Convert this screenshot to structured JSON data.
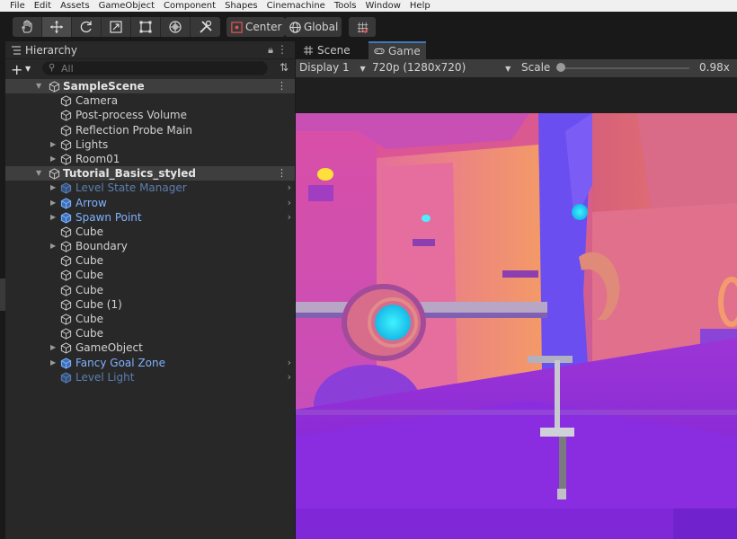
{
  "menu": [
    "File",
    "Edit",
    "Assets",
    "GameObject",
    "Component",
    "Shapes",
    "Cinemachine",
    "Tools",
    "Window",
    "Help"
  ],
  "toolbar": {
    "tools": [
      {
        "name": "hand-tool",
        "icon": "hand-icon"
      },
      {
        "name": "move-tool",
        "icon": "move-icon",
        "active": true
      },
      {
        "name": "rotate-tool",
        "icon": "rotate-icon"
      },
      {
        "name": "scale-tool",
        "icon": "scale-icon"
      },
      {
        "name": "rect-tool",
        "icon": "rect-icon"
      },
      {
        "name": "transform-tool",
        "icon": "transform-icon"
      },
      {
        "name": "custom-tool",
        "icon": "tools-icon"
      }
    ],
    "pivot_label": "Center",
    "space_label": "Global"
  },
  "hierarchy": {
    "title": "Hierarchy",
    "search_placeholder": "All",
    "scenes": [
      {
        "label": "SampleScene",
        "items": [
          {
            "label": "Camera",
            "style": "normal",
            "fold": false
          },
          {
            "label": "Post-process Volume",
            "style": "normal",
            "fold": false
          },
          {
            "label": "Reflection Probe Main",
            "style": "normal",
            "fold": false
          },
          {
            "label": "Lights",
            "style": "normal",
            "fold": true
          },
          {
            "label": "Room01",
            "style": "normal",
            "fold": true
          }
        ]
      },
      {
        "label": "Tutorial_Basics_styled",
        "items": [
          {
            "label": "Level State Manager",
            "style": "prefab-dim",
            "fold": true,
            "chevron": true
          },
          {
            "label": "Arrow",
            "style": "prefab",
            "fold": true,
            "chevron": true
          },
          {
            "label": "Spawn Point",
            "style": "prefab",
            "fold": true,
            "chevron": true
          },
          {
            "label": "Cube",
            "style": "normal",
            "fold": false
          },
          {
            "label": "Boundary",
            "style": "normal",
            "fold": true
          },
          {
            "label": "Cube",
            "style": "normal",
            "fold": false
          },
          {
            "label": "Cube",
            "style": "normal",
            "fold": false
          },
          {
            "label": "Cube",
            "style": "normal",
            "fold": false
          },
          {
            "label": "Cube (1)",
            "style": "normal",
            "fold": false
          },
          {
            "label": "Cube",
            "style": "normal",
            "fold": false
          },
          {
            "label": "Cube",
            "style": "normal",
            "fold": false
          },
          {
            "label": "GameObject",
            "style": "normal",
            "fold": true
          },
          {
            "label": "Fancy Goal Zone",
            "style": "prefab",
            "fold": true,
            "chevron": true
          },
          {
            "label": "Level Light",
            "style": "prefab-dim",
            "fold": false,
            "chevron": true
          }
        ]
      }
    ]
  },
  "game": {
    "tabs": [
      {
        "label": "Scene",
        "icon": "grid-icon",
        "active": false
      },
      {
        "label": "Game",
        "icon": "gamepad-icon",
        "active": true
      }
    ],
    "display": "Display 1",
    "resolution": "720p (1280x720)",
    "scale_label": "Scale",
    "scale_value": "0.98x"
  },
  "colors": {
    "accent": "#3a79bb",
    "prefab": "#7fb2ff",
    "prefab_dim": "#5c7eb0"
  }
}
